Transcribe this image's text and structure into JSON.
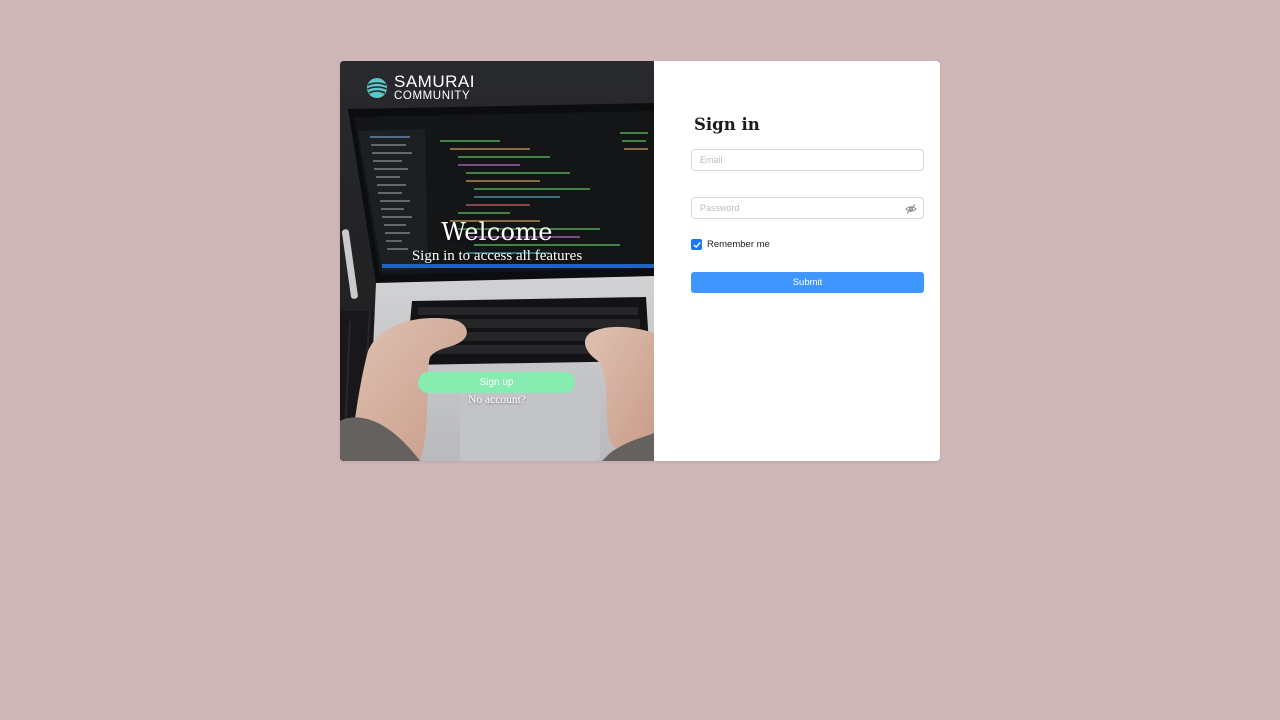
{
  "brand": {
    "name_line1": "SAMURAI",
    "name_line2": "COMMUNITY",
    "logo_icon": "globe-icon",
    "logo_color": "#5ec6c8"
  },
  "hero": {
    "welcome": "Welcome",
    "subtitle": "Sign in to access all features",
    "signup_label": "Sign up",
    "no_account": "No account?",
    "signup_color": "#86ecb0"
  },
  "form": {
    "title": "Sign in",
    "email_placeholder": "Email",
    "password_placeholder": "Password",
    "password_toggle_icon": "eye-slash-icon",
    "remember_label": "Remember me",
    "remember_checked": true,
    "submit_label": "Submit",
    "accent": "#4096ff"
  },
  "colors": {
    "background": "#cfb6b6",
    "card": "#ffffff"
  }
}
